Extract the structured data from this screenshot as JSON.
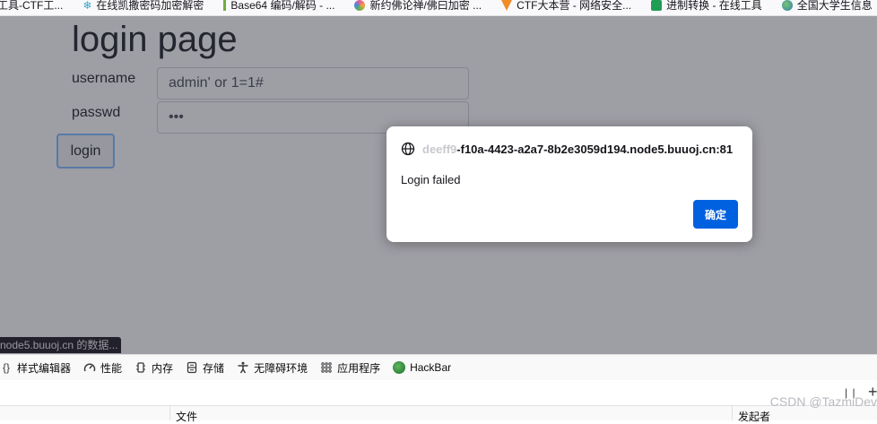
{
  "bookmarks": [
    {
      "label": "工具-CTF工...",
      "icon": "none"
    },
    {
      "label": "在线凯撒密码加密解密",
      "icon": "snowflake-icon"
    },
    {
      "label": "Base64 编码/解码 - ...",
      "icon": "bar-icon"
    },
    {
      "label": "新约佛论禅/佛曰加密 ...",
      "icon": "swirl-icon"
    },
    {
      "label": "CTF大本营 - 网络安全...",
      "icon": "ctf-icon"
    },
    {
      "label": "进制转换 - 在线工具",
      "icon": "green-square-icon"
    },
    {
      "label": "全国大学生信息",
      "icon": "globe-icon"
    }
  ],
  "page": {
    "title": "login page",
    "username_label": "username",
    "username_value": "admin' or 1=1#",
    "password_label": "passwd",
    "password_value": "abc",
    "login_label": "login"
  },
  "status_bar": "node5.buuoj.cn 的数据...",
  "dialog": {
    "origin_faded": "deeff9",
    "origin": "-f10a-4423-a2a7-8b2e3059d194.node5.buuoj.cn:81",
    "message": "Login failed",
    "ok_label": "确定"
  },
  "devtools": {
    "tabs": [
      {
        "label": "样式编辑器",
        "icon": "braces-icon"
      },
      {
        "label": "性能",
        "icon": "gauge-icon"
      },
      {
        "label": "内存",
        "icon": "memory-icon"
      },
      {
        "label": "存储",
        "icon": "storage-icon"
      },
      {
        "label": "无障碍环境",
        "icon": "accessibility-icon"
      },
      {
        "label": "应用程序",
        "icon": "grid-icon"
      },
      {
        "label": "HackBar",
        "icon": "hackbar-icon"
      }
    ],
    "col_file": "文件",
    "col_initiator": "发起者"
  },
  "watermark": "CSDN @TazmiDev"
}
